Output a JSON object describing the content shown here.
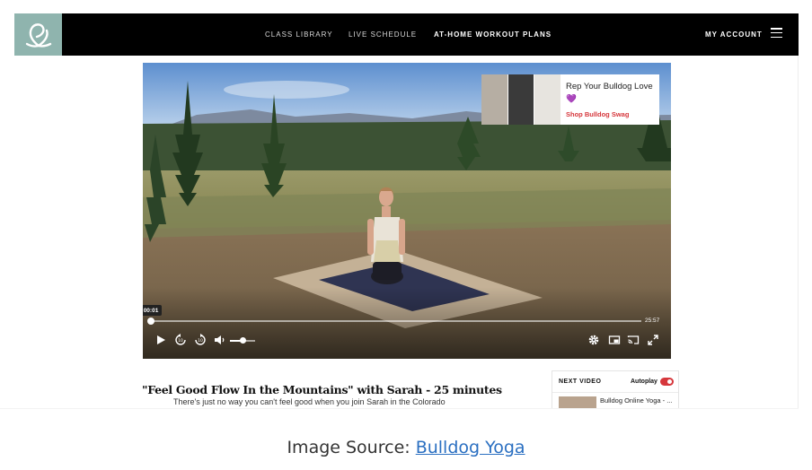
{
  "header": {
    "nav": [
      "CLASS LIBRARY",
      "LIVE SCHEDULE",
      "AT-HOME WORKOUT PLANS"
    ],
    "account": "MY ACCOUNT"
  },
  "video": {
    "current_time": "00:01",
    "duration": "25:57",
    "progress": 0.001,
    "volume": 0.5,
    "promo": {
      "title": "Rep Your Bulldog Love 💜",
      "link": "Shop Bulldog Swag"
    }
  },
  "details": {
    "title": "\"Feel Good Flow In the Mountains\" with Sarah - 25 minutes",
    "description": "There's just no way you can't feel good when you join Sarah in the Colorado"
  },
  "next_video": {
    "label": "NEXT VIDEO",
    "autoplay_label": "Autoplay",
    "autoplay_on": true,
    "item_title": "Bulldog Online Yoga - ..."
  },
  "caption": {
    "prefix": "Image Source: ",
    "link": "Bulldog Yoga"
  },
  "colors": {
    "header_bg": "#000000",
    "logo_bg": "#8fb4ae",
    "accent_red": "#d6373c",
    "link_blue": "#2a6fc1"
  }
}
